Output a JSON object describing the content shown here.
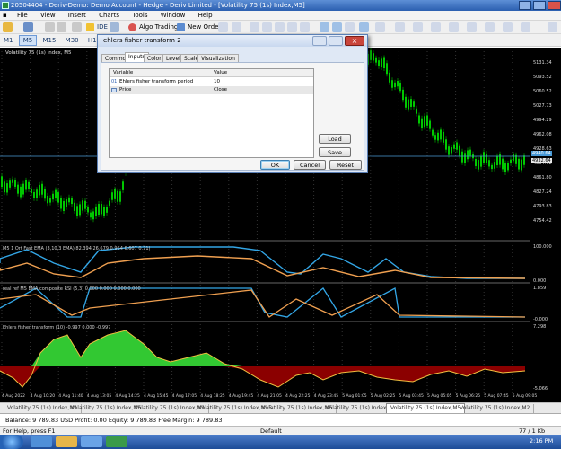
{
  "window": {
    "title": "20504404 - Deriv-Demo: Demo Account - Hedge - Deriv Limited - [Volatility 75 (1s) Index,M5]"
  },
  "menu": [
    "File",
    "View",
    "Insert",
    "Charts",
    "Tools",
    "Window",
    "Help"
  ],
  "toolbar": {
    "algo_trading": "Algo Trading",
    "new_order": "New Order",
    "ide": "IDE"
  },
  "timeframes": [
    "M1",
    "M5",
    "M15",
    "M30",
    "H1",
    "H4"
  ],
  "selected_timeframe": "M5",
  "chart": {
    "symbol_label": "Volatility 75 (1s) Index, M5",
    "price_labels": [
      "5131.34",
      "5093.52",
      "5060.52",
      "5027.73",
      "4994.29",
      "4962.08",
      "4928.63",
      "4894.72",
      "4861.80",
      "4827.24",
      "4793.83",
      "4754.42"
    ],
    "current_price": "4932.64",
    "horizontal_line_price": "4940.64",
    "indicator1_label": "M5 1 Ort Fast EMA (3,10,3 EMA) 82.394 26.679 0.964 6.607 0.71)",
    "indicator1_levels": [
      "100.000",
      "0.000"
    ],
    "indicator2_label": "real ref M5 EMA composite RSI (5,3) 0.000 0.000 0.000 0.000",
    "indicator2_levels": [
      "1.859",
      "-0.000"
    ],
    "indicator3_label": "Ehlers fisher transform (10) -0.997 0.000 -0.997",
    "indicator3_levels": [
      "7.298",
      "-5.066"
    ]
  },
  "time_labels": [
    "4 Aug 2022",
    "4 Aug 10:20",
    "4 Aug 11:40",
    "4 Aug 13:05",
    "4 Aug 14:25",
    "4 Aug 15:45",
    "4 Aug 17:05",
    "4 Aug 18:25",
    "4 Aug 19:45",
    "4 Aug 21:05",
    "4 Aug 22:25",
    "4 Aug 23:45",
    "5 Aug 01:05",
    "5 Aug 02:25",
    "5 Aug 03:45",
    "5 Aug 05:05",
    "5 Aug 06:25",
    "5 Aug 07:45",
    "5 Aug 09:05"
  ],
  "chart_tabs": [
    "Volatility 75 (1s) Index,M1",
    "Volatility 75 (1s) Index,M5",
    "Volatility 75 (1s) Index,M1",
    "Volatility 75 (1s) Index,M15",
    "Volatility 75 (1s) Index,M5",
    "Volatility 75 (1s) Index,M5",
    "Volatility 75 (1s) Index,M5",
    "Volatility 75 (1s) Index,M2"
  ],
  "active_tab_index": 6,
  "terminal": {
    "text": "Balance: 9 789.83 USD  Profit: 0.00  Equity: 9 789.83  Free Margin: 9 789.83"
  },
  "status": {
    "help": "For Help, press F1",
    "profile": "Default",
    "connection": "77 / 1 Kb"
  },
  "clock": "2:16 PM",
  "dialog": {
    "title": "ehlers fisher transform 2",
    "tabs": [
      "Common",
      "Inputs",
      "Colors",
      "Levels",
      "Scale",
      "Visualization"
    ],
    "active_tab": "Inputs",
    "columns": [
      "Variable",
      "Value"
    ],
    "rows": [
      {
        "icon": "01",
        "variable": "Ehlers fisher transform period",
        "value": "10"
      },
      {
        "icon": "price-icon",
        "variable": "Price",
        "value": "Close"
      }
    ],
    "load": "Load",
    "save": "Save",
    "ok": "OK",
    "cancel": "Cancel",
    "reset": "Reset"
  },
  "colors": {
    "bull_candle": "#00c800",
    "bear_candle": "#00c800",
    "fisher_positive": "#32c832",
    "fisher_negative": "#8b0000",
    "line_blue": "#33a6e6",
    "line_orange": "#f0a050",
    "hline": "#4a9ad6"
  }
}
